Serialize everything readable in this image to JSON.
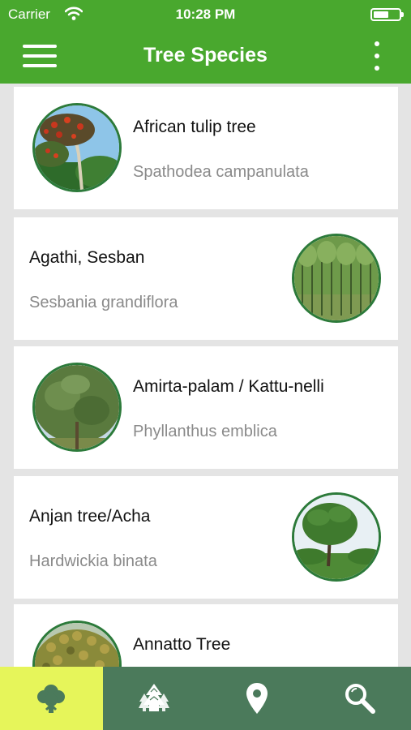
{
  "status_bar": {
    "carrier": "Carrier",
    "time": "10:28 PM",
    "wifi_icon": "wifi-icon",
    "battery_icon": "battery-icon"
  },
  "app_bar": {
    "title": "Tree Species",
    "menu_icon": "hamburger-menu-icon",
    "overflow_icon": "more-vertical-icon"
  },
  "colors": {
    "primary": "#49a82e",
    "tab_bar": "#4b7a5b",
    "tab_active": "#e6f55a",
    "thumb_border": "#2c7a3a",
    "secondary_text": "#8a8a8a"
  },
  "species": [
    {
      "common_name": "African tulip tree",
      "scientific_name": "Spathodea campanulata",
      "image_side": "left"
    },
    {
      "common_name": "Agathi, Sesban",
      "scientific_name": "Sesbania grandiflora",
      "image_side": "right"
    },
    {
      "common_name": "Amirta-palam / Kattu-nelli",
      "scientific_name": "Phyllanthus emblica",
      "image_side": "left"
    },
    {
      "common_name": "Anjan tree/Acha",
      "scientific_name": "Hardwickia binata",
      "image_side": "right"
    },
    {
      "common_name": "Annatto Tree",
      "scientific_name": "",
      "image_side": "left"
    }
  ],
  "tab_bar": {
    "tabs": [
      {
        "icon": "tree-icon",
        "active": true
      },
      {
        "icon": "forest-icon",
        "active": false
      },
      {
        "icon": "location-pin-icon",
        "active": false
      },
      {
        "icon": "search-icon",
        "active": false
      }
    ]
  }
}
